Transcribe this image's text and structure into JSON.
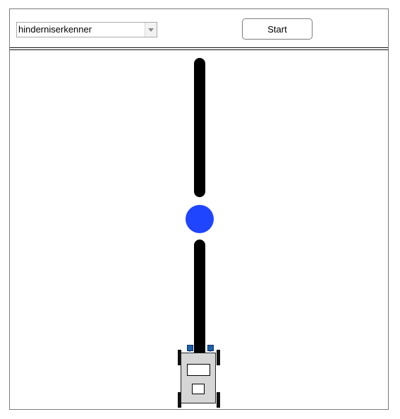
{
  "toolbar": {
    "program_select": {
      "selected": "hinderniserkenner"
    },
    "start_label": "Start"
  },
  "arena": {
    "obstacle_color": "#1f45ff",
    "track_color": "#000000",
    "robot": {
      "body_color": "#d6d6d6",
      "sensor_color": "#1d5fa8"
    }
  }
}
